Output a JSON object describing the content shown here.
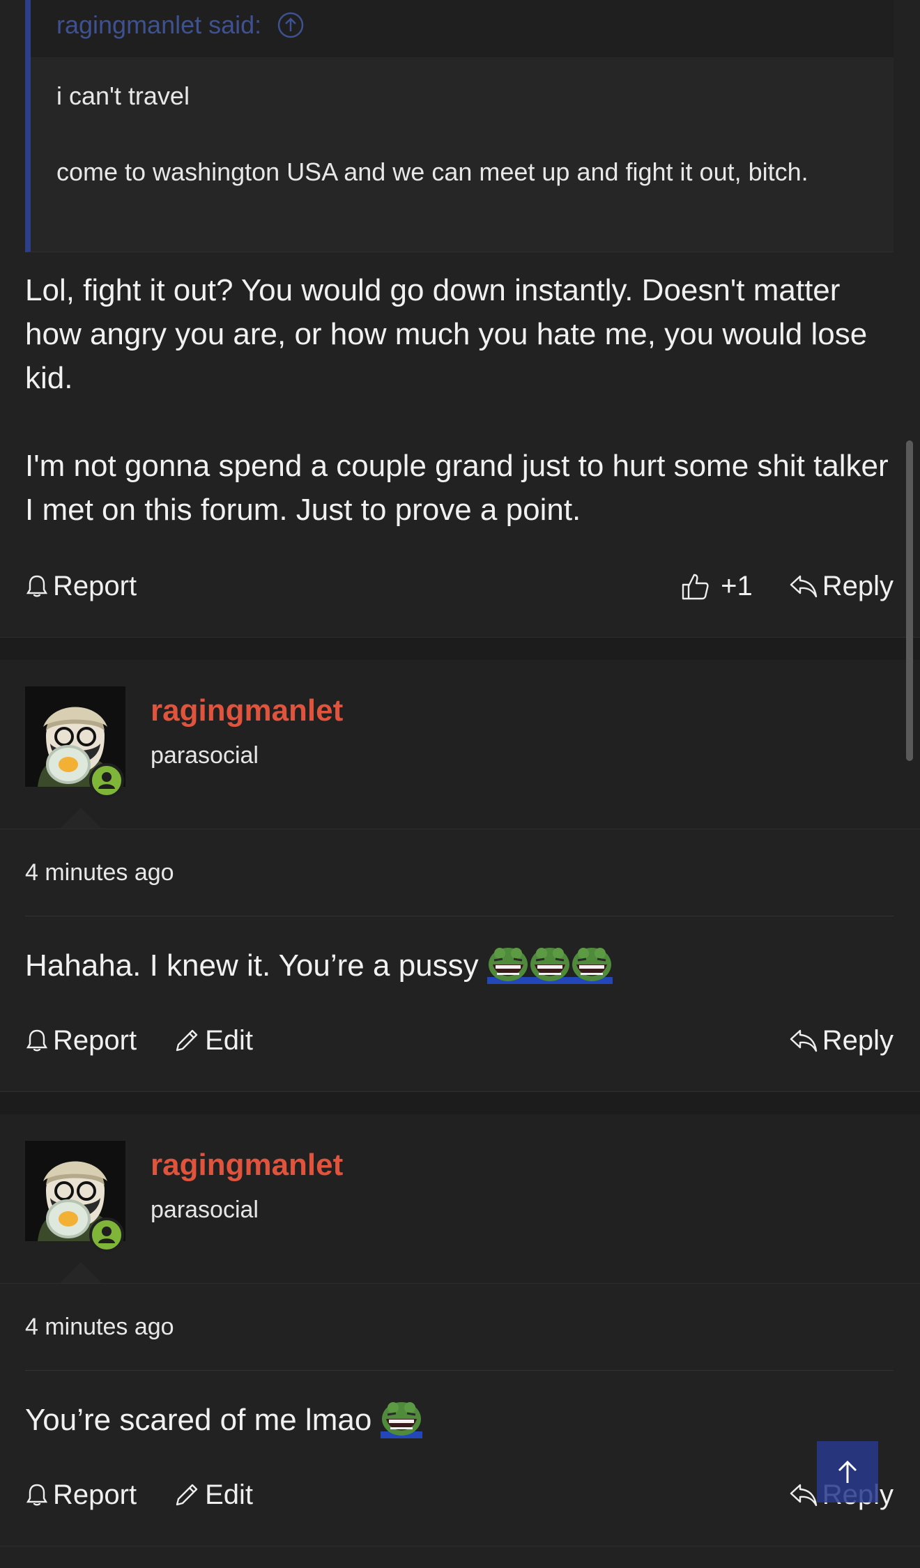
{
  "quote": {
    "attribution": "ragingmanlet said:",
    "lines": [
      "i can't travel",
      "come to washington USA and we can meet up and fight it out, bitch."
    ]
  },
  "post1": {
    "paragraphs": [
      "Lol, fight it out? You would go down instantly. Doesn't matter how angry you are, or how much you hate me, you would lose kid.",
      "I'm not gonna spend a couple grand just to hurt some shit talker I met on this forum. Just to prove a point."
    ],
    "report_label": "Report",
    "like_count": "+1",
    "reply_label": "Reply"
  },
  "post2": {
    "username": "ragingmanlet",
    "user_title": "parasocial",
    "timestamp": "4 minutes ago",
    "text": "Hahaha. I knew it. You’re a pussy",
    "emote_count": 3,
    "emote_icon": "laughing-frog-emote",
    "report_label": "Report",
    "edit_label": "Edit",
    "reply_label": "Reply"
  },
  "post3": {
    "username": "ragingmanlet",
    "user_title": "parasocial",
    "timestamp": "4 minutes ago",
    "text": "You’re scared of me lmao",
    "emote_count": 1,
    "emote_icon": "laughing-frog-emote",
    "report_label": "Report",
    "edit_label": "Edit",
    "reply_label": "Reply"
  },
  "colors": {
    "background": "#222222",
    "username": "#e0533c",
    "quote_accent": "#2e3f8a",
    "online_badge": "#7fb539"
  }
}
